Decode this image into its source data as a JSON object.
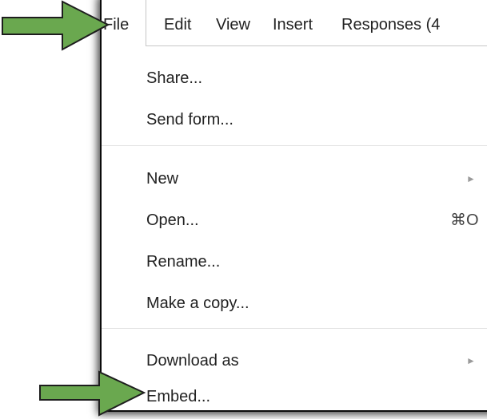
{
  "menubar": {
    "items": [
      {
        "label": "File"
      },
      {
        "label": "Edit"
      },
      {
        "label": "View"
      },
      {
        "label": "Insert"
      },
      {
        "label": "Responses (4"
      }
    ]
  },
  "file_menu": {
    "items": [
      {
        "label": "Share..."
      },
      {
        "label": "Send form..."
      },
      {
        "label": "New",
        "arrow": "►"
      },
      {
        "label": "Open...",
        "shortcut": "⌘O"
      },
      {
        "label": "Rename..."
      },
      {
        "label": "Make a copy..."
      },
      {
        "label": "Download as",
        "arrow": "►"
      },
      {
        "label": "Embed..."
      }
    ]
  },
  "colors": {
    "arrow_fill": "#6aa84f",
    "arrow_stroke": "#1e1e1e",
    "frame_shadow": "#0b0b0b"
  }
}
